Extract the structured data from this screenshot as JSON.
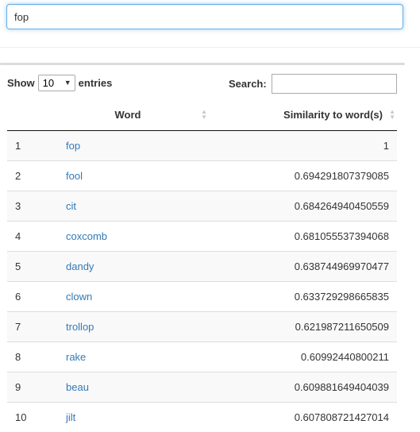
{
  "query": {
    "value": "fop"
  },
  "length": {
    "label_before": "Show",
    "selected": "10",
    "label_after": "entries"
  },
  "search": {
    "label": "Search:",
    "value": ""
  },
  "table": {
    "headers": {
      "index": "",
      "word": "Word",
      "similarity": "Similarity to word(s)"
    },
    "rows": [
      {
        "index": "1",
        "word": "fop",
        "similarity": "1"
      },
      {
        "index": "2",
        "word": "fool",
        "similarity": "0.694291807379085"
      },
      {
        "index": "3",
        "word": "cit",
        "similarity": "0.684264940450559"
      },
      {
        "index": "4",
        "word": "coxcomb",
        "similarity": "0.681055537394068"
      },
      {
        "index": "5",
        "word": "dandy",
        "similarity": "0.638744969970477"
      },
      {
        "index": "6",
        "word": "clown",
        "similarity": "0.633729298665835"
      },
      {
        "index": "7",
        "word": "trollop",
        "similarity": "0.621987211650509"
      },
      {
        "index": "8",
        "word": "rake",
        "similarity": "0.60992440800211"
      },
      {
        "index": "9",
        "word": "beau",
        "similarity": "0.609881649404039"
      },
      {
        "index": "10",
        "word": "jilt",
        "similarity": "0.607808721427014"
      }
    ]
  },
  "colors": {
    "link": "#337ab7",
    "focus_border": "#66afe9",
    "stripe": "#f9f9f9"
  },
  "icons": {
    "sort": "sort-both-icon",
    "dropdown": "caret-down-icon"
  }
}
